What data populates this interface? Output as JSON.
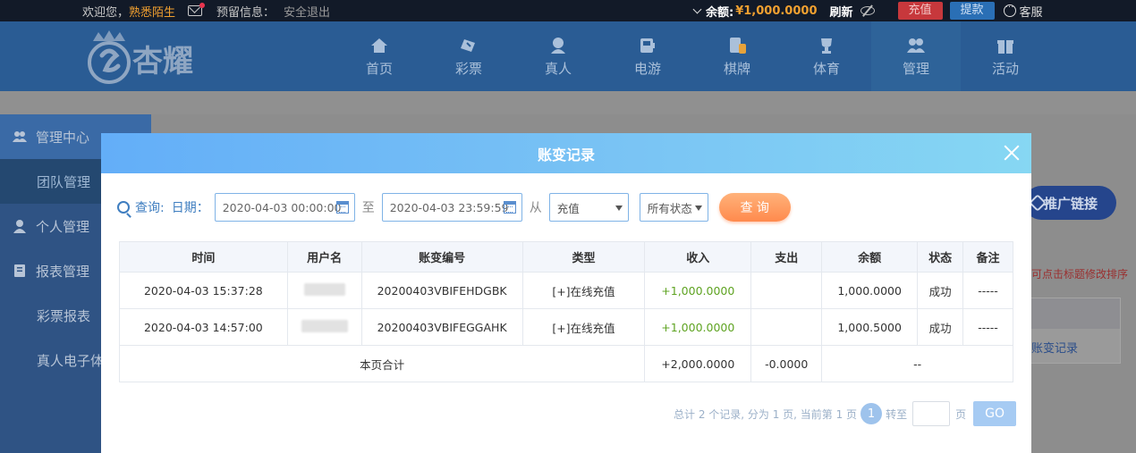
{
  "topbar": {
    "welcome": "欢迎您，",
    "nickname": "熟悉陌生",
    "notice_label": "预留信息：",
    "logout": "安全退出",
    "balance_label": "余额:",
    "balance_value": "¥1,000.0000",
    "refresh": "刷新",
    "recharge": "充值",
    "withdraw": "提款",
    "customer_service": "客服"
  },
  "logo": {
    "text": "杏耀"
  },
  "nav": [
    {
      "label": "首页",
      "icon": "home-icon"
    },
    {
      "label": "彩票",
      "icon": "lottery-icon"
    },
    {
      "label": "真人",
      "icon": "live-dealer-icon"
    },
    {
      "label": "电游",
      "icon": "slot-icon"
    },
    {
      "label": "棋牌",
      "icon": "cards-icon"
    },
    {
      "label": "体育",
      "icon": "trophy-icon"
    },
    {
      "label": "管理",
      "icon": "users-icon"
    },
    {
      "label": "活动",
      "icon": "gift-icon"
    }
  ],
  "sidebar": {
    "items": [
      {
        "label": "管理中心",
        "type": "head",
        "icon": "users-icon"
      },
      {
        "label": "团队管理",
        "type": "sub"
      },
      {
        "label": "个人管理",
        "type": "head",
        "icon": "user-icon"
      },
      {
        "label": "报表管理",
        "type": "head",
        "icon": "report-icon"
      },
      {
        "label": "彩票报表",
        "type": "sub"
      },
      {
        "label": "真人电子体",
        "type": "sub"
      }
    ]
  },
  "background": {
    "promo_link": "推广链接",
    "sort_hint": "可点击标题修改排序",
    "record_link": "账变记录"
  },
  "modal": {
    "title": "账变记录",
    "query_label": "查询:",
    "date_label": "日期：",
    "start_date": "2020-04-03 00:00:00",
    "to_label": "至",
    "end_date": "2020-04-03 23:59:59",
    "from_label": "从",
    "type_select": "充值",
    "status_select": "所有状态",
    "query_button": "查 询",
    "table": {
      "headers": [
        "时间",
        "用户名",
        "账变编号",
        "类型",
        "收入",
        "支出",
        "余额",
        "状态",
        "备注"
      ],
      "rows": [
        {
          "time": "2020-04-03 15:37:28",
          "order": "20200403VBIFEHDGBK",
          "type": "[+]在线充值",
          "income": "+1,000.0000",
          "expense": "",
          "balance": "1,000.0000",
          "status": "成功",
          "remark": "-----"
        },
        {
          "time": "2020-04-03 14:57:00",
          "order": "20200403VBIFEGGAHK",
          "type": "[+]在线充值",
          "income": "+1,000.0000",
          "expense": "",
          "balance": "1,000.5000",
          "status": "成功",
          "remark": "-----"
        }
      ],
      "summary": {
        "label": "本页合计",
        "income": "+2,000.0000",
        "expense": "-0.0000",
        "balance": "--"
      }
    },
    "pager": {
      "info": "总计 2 个记录, 分为 1 页, 当前第 1 页",
      "current": "1",
      "goto_label": "转至",
      "page_unit": "页",
      "go_button": "GO"
    }
  }
}
